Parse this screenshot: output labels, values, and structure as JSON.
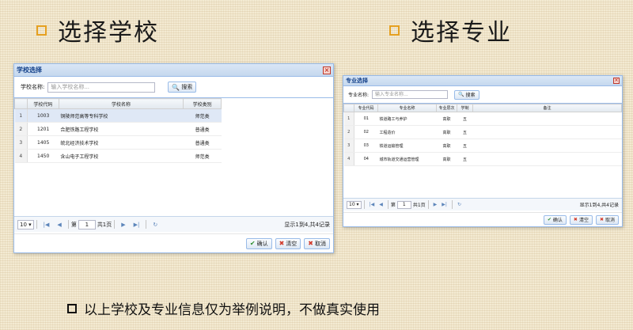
{
  "headings": {
    "left": "选择学校",
    "right": "选择专业"
  },
  "school_dialog": {
    "title": "学校选择",
    "search_label": "学校名称:",
    "search_placeholder": "输入学校名称...",
    "search_button": "搜索",
    "columns": [
      "学校代码",
      "学校名称",
      "学校类别"
    ],
    "rows": [
      {
        "no": "1",
        "code": "1003",
        "name": "铜陵师范高等专科学校",
        "type": "师范类"
      },
      {
        "no": "2",
        "code": "1201",
        "name": "合肥铁路工程学校",
        "type": "普通类"
      },
      {
        "no": "3",
        "code": "1405",
        "name": "皖北经济技术学校",
        "type": "普通类"
      },
      {
        "no": "4",
        "code": "1450",
        "name": "含山电子工程学校",
        "type": "师范类"
      }
    ],
    "pager": {
      "page_size": "10",
      "page_label": "第",
      "page_value": "1",
      "total_pages": "共1页",
      "info": "显示1到4,共4记录"
    },
    "buttons": {
      "ok": "确认",
      "clear": "清空",
      "cancel": "取消"
    }
  },
  "major_dialog": {
    "title": "专业选择",
    "search_label": "专业名称:",
    "search_placeholder": "输入专业名称...",
    "search_button": "搜索",
    "columns": [
      "专业代码",
      "专业名称",
      "专业层次",
      "学制",
      "备注"
    ],
    "rows": [
      {
        "no": "1",
        "code": "01",
        "name": "铁道路工与养护",
        "level": "高职",
        "years": "五",
        "note": ""
      },
      {
        "no": "2",
        "code": "02",
        "name": "工程造价",
        "level": "高职",
        "years": "五",
        "note": ""
      },
      {
        "no": "3",
        "code": "03",
        "name": "铁道运输管理",
        "level": "高职",
        "years": "五",
        "note": ""
      },
      {
        "no": "4",
        "code": "04",
        "name": "城市轨道交通运营管理",
        "level": "高职",
        "years": "五",
        "note": ""
      }
    ],
    "pager": {
      "page_size": "10",
      "page_label": "第",
      "page_value": "1",
      "total_pages": "共1页",
      "info": "显示1到4,共4记录"
    },
    "buttons": {
      "ok": "确认",
      "clear": "清空",
      "cancel": "取消"
    }
  },
  "bullet_text": "以上学校及专业信息仅为举例说明，不做真实使用",
  "colors": {
    "accent": "#e5a020",
    "panel_border": "#99bbe8",
    "selected_row": "#dfe8f6"
  }
}
